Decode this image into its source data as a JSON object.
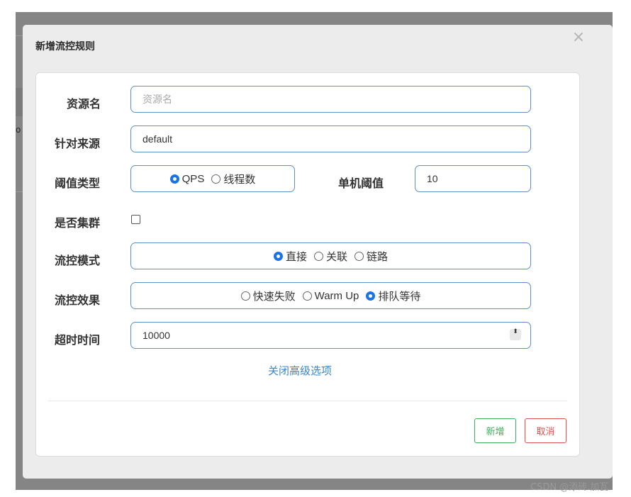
{
  "background": {
    "fragment_text": "o"
  },
  "dialog": {
    "title": "新增流控规则",
    "close_symbol": "×"
  },
  "form": {
    "resource": {
      "label": "资源名",
      "placeholder": "资源名",
      "value": ""
    },
    "origin": {
      "label": "针对来源",
      "value": "default"
    },
    "threshold_type": {
      "label": "阈值类型",
      "options": [
        {
          "label": "QPS",
          "selected": true
        },
        {
          "label": "线程数",
          "selected": false
        }
      ]
    },
    "single_threshold": {
      "label": "单机阈值",
      "value": "10"
    },
    "cluster": {
      "label": "是否集群",
      "checked": false
    },
    "control_mode": {
      "label": "流控模式",
      "options": [
        {
          "label": "直接",
          "selected": true
        },
        {
          "label": "关联",
          "selected": false
        },
        {
          "label": "链路",
          "selected": false
        }
      ]
    },
    "control_effect": {
      "label": "流控效果",
      "options": [
        {
          "label": "快速失败",
          "selected": false
        },
        {
          "label": "Warm Up",
          "selected": false
        },
        {
          "label": "排队等待",
          "selected": true
        }
      ]
    },
    "timeout": {
      "label": "超时时间",
      "value": "10000",
      "stepper_symbol": "⬍"
    },
    "advanced_link": "关闭高级选项"
  },
  "footer": {
    "add_label": "新增",
    "cancel_label": "取消"
  },
  "watermark": "CSDN @添砖.加瓦",
  "colors": {
    "accent": "#3a87c8",
    "field_border": "#5b8fc7",
    "add": "#3fae5a",
    "cancel": "#d9534f",
    "radio_on": "#1a73e8"
  }
}
